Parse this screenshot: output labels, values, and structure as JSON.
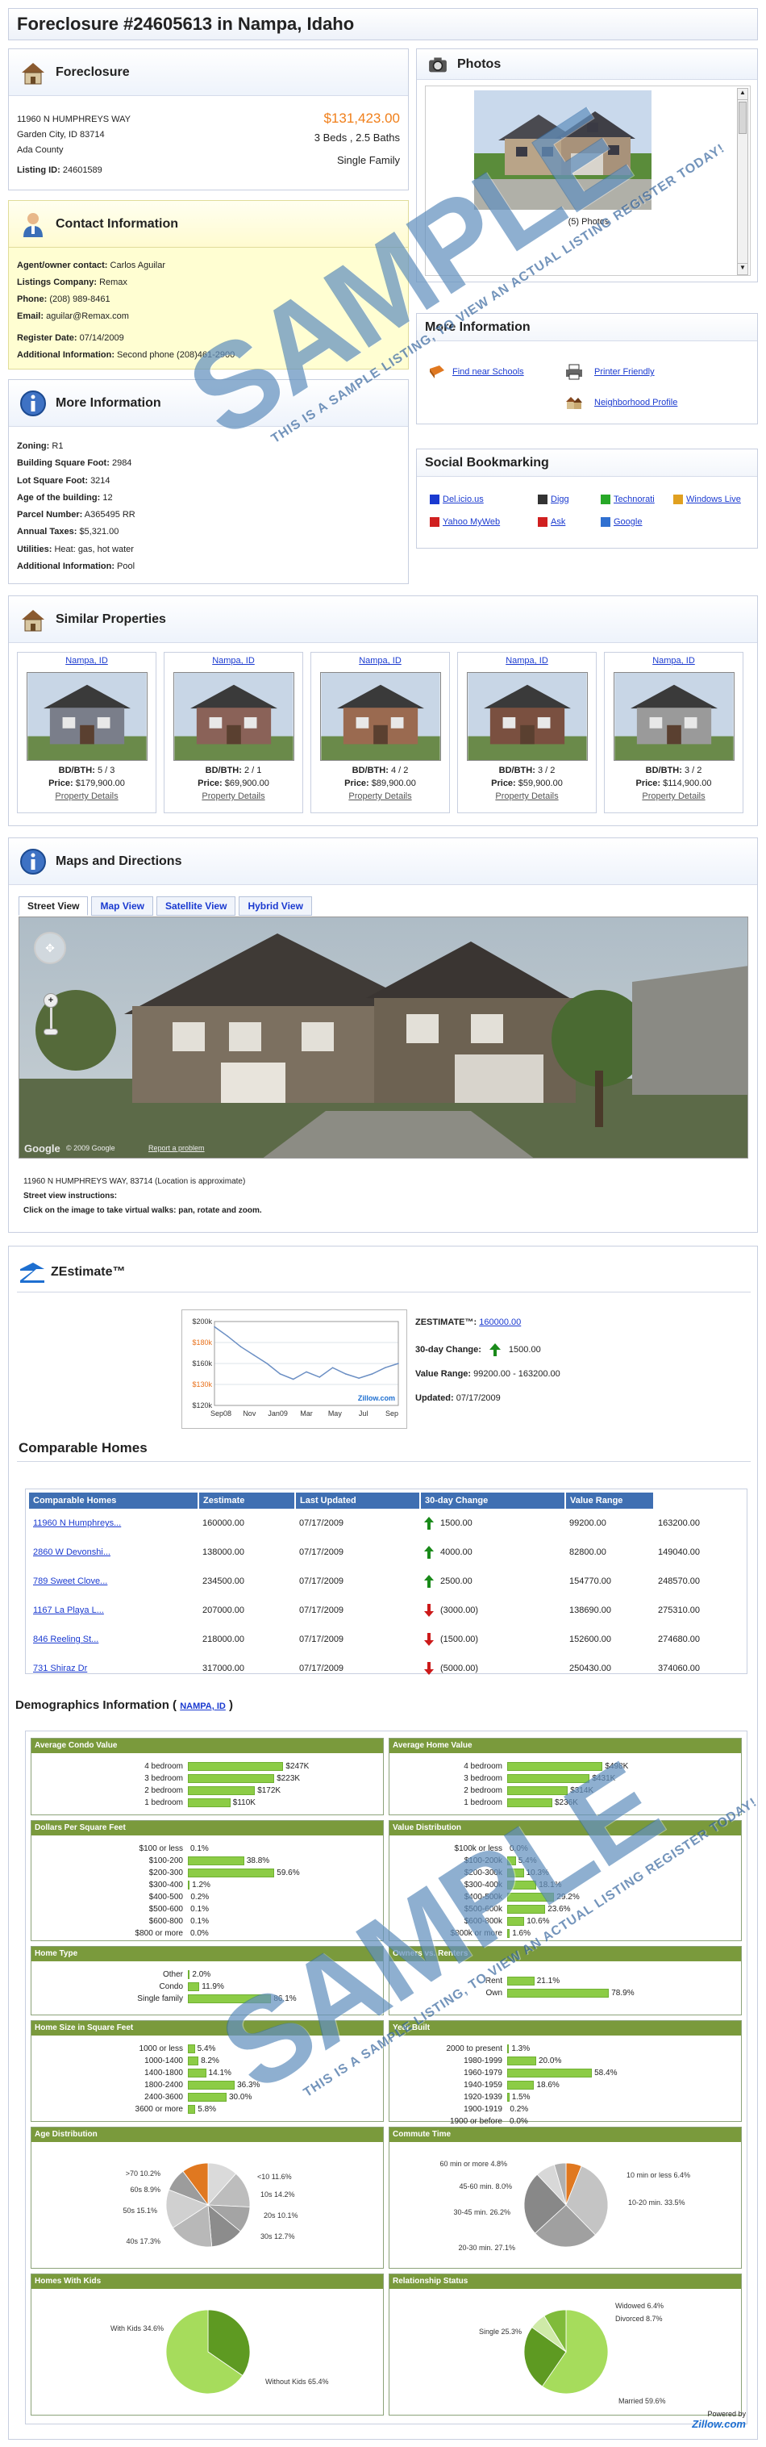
{
  "page_title": "Foreclosure #24605613 in Nampa, Idaho",
  "watermark": {
    "big": "SAMPLE",
    "small": "THIS IS A SAMPLE LISTING, TO VIEW AN ACTUAL LISTING REGISTER TODAY!"
  },
  "foreclosure": {
    "heading": "Foreclosure",
    "address1": "11960 N HUMPHREYS WAY",
    "address2": "Garden City, ID 83714",
    "county": "Ada County",
    "listing_label": "Listing ID:",
    "listing_id": "24601589",
    "price": "$131,423.00",
    "beds_baths": "3 Beds , 2.5 Baths",
    "type": "Single Family"
  },
  "contact": {
    "heading": "Contact Information",
    "rows": [
      {
        "label": "Agent/owner contact:",
        "value": "Carlos Aguilar"
      },
      {
        "label": "Listings Company:",
        "value": "Remax"
      },
      {
        "label": "Phone:",
        "value": "(208) 989-8461"
      },
      {
        "label": "Email:",
        "value": "aguilar@Remax.com"
      },
      {
        "label": "Register Date:",
        "value": "07/14/2009"
      },
      {
        "label": "Additional Information:",
        "value": "Second phone (208)461-2900"
      }
    ]
  },
  "more_info": {
    "heading": "More Information",
    "rows": [
      {
        "label": "Zoning:",
        "value": "R1"
      },
      {
        "label": "Building Square Foot:",
        "value": "2984"
      },
      {
        "label": "Lot Square Foot:",
        "value": "3214"
      },
      {
        "label": "Age of the building:",
        "value": "12"
      },
      {
        "label": "Parcel Number:",
        "value": "A365495 RR"
      },
      {
        "label": "Annual Taxes:",
        "value": "$5,321.00"
      },
      {
        "label": "Utilities:",
        "value": "Heat: gas, hot water"
      },
      {
        "label": "Additional Information:",
        "value": "Pool"
      }
    ]
  },
  "photos": {
    "heading": "Photos",
    "caption": "(5) Photos"
  },
  "more_links": {
    "heading": "More Information",
    "schools": "Find near Schools",
    "printer": "Printer Friendly",
    "neighborhood": "Neighborhood Profile"
  },
  "social": {
    "heading": "Social Bookmarking",
    "items": [
      "Del.icio.us",
      "Digg",
      "Technorati",
      "Windows Live",
      "Yahoo MyWeb",
      "Ask",
      "Google"
    ]
  },
  "similar": {
    "heading": "Similar Properties",
    "bd_label": "BD/BTH:",
    "price_label": "Price:",
    "details": "Property Details",
    "items": [
      {
        "city": "Nampa, ID",
        "bdbth": "5 / 3",
        "price": "$179,900.00",
        "color": "#7a7e8a"
      },
      {
        "city": "Nampa, ID",
        "bdbth": "2 / 1",
        "price": "$69,900.00",
        "color": "#8a6258"
      },
      {
        "city": "Nampa, ID",
        "bdbth": "4 / 2",
        "price": "$89,900.00",
        "color": "#9a6a50"
      },
      {
        "city": "Nampa, ID",
        "bdbth": "3 / 2",
        "price": "$59,900.00",
        "color": "#7a5040"
      },
      {
        "city": "Nampa, ID",
        "bdbth": "3 / 2",
        "price": "$114,900.00",
        "color": "#9a9a9a"
      }
    ]
  },
  "maps": {
    "heading": "Maps and Directions",
    "tabs": [
      "Street View",
      "Map View",
      "Satellite View",
      "Hybrid View"
    ],
    "copyright": "© 2009 Google",
    "report": "Report a problem",
    "location": "11960 N HUMPHREYS WAY, 83714 (Location is approximate)",
    "instr_title": "Street view instructions:",
    "instr": "Click on the image to take virtual walks: pan, rotate and zoom."
  },
  "zestimate": {
    "heading": "ZEstimate™",
    "label": "ZESTIMATE™:",
    "value": "160000.00",
    "change_label": "30-day Change:",
    "change": "1500.00",
    "range_label": "Value Range:",
    "range": "99200.00 - 163200.00",
    "updated_label": "Updated:",
    "updated": "07/17/2009",
    "zillow": "Zillow.com"
  },
  "chart_data": {
    "type": "line",
    "title": "",
    "x": [
      "Sep08",
      "Nov",
      "Jan09",
      "Mar",
      "May",
      "Jul",
      "Sep"
    ],
    "y_ticks": [
      "$200k",
      "$180k",
      "$160k",
      "$130k",
      "$120k"
    ],
    "series": [
      {
        "values": [
          195,
          186,
          176,
          168,
          160,
          150,
          145,
          152,
          147,
          156,
          150,
          146,
          150,
          156,
          160
        ]
      }
    ],
    "ylim": [
      120,
      200
    ],
    "xlabel": "",
    "ylabel": "",
    "grid": true
  },
  "comparable": {
    "heading": "Comparable Homes",
    "headers": [
      "Comparable Homes",
      "Zestimate",
      "Last Updated",
      "30-day Change",
      "Value Range"
    ],
    "rows": [
      {
        "name": "11960 N Humphreys...",
        "zest": "160000.00",
        "date": "07/17/2009",
        "dir": "up",
        "change": "1500.00",
        "low": "99200.00",
        "high": "163200.00"
      },
      {
        "name": "2860 W Devonshi...",
        "zest": "138000.00",
        "date": "07/17/2009",
        "dir": "up",
        "change": "4000.00",
        "low": "82800.00",
        "high": "149040.00"
      },
      {
        "name": "789 Sweet Clove...",
        "zest": "234500.00",
        "date": "07/17/2009",
        "dir": "up",
        "change": "2500.00",
        "low": "154770.00",
        "high": "248570.00"
      },
      {
        "name": "1167 La Playa L...",
        "zest": "207000.00",
        "date": "07/17/2009",
        "dir": "down",
        "change": "(3000.00)",
        "low": "138690.00",
        "high": "275310.00"
      },
      {
        "name": "846 Reeling St...",
        "zest": "218000.00",
        "date": "07/17/2009",
        "dir": "down",
        "change": "(1500.00)",
        "low": "152600.00",
        "high": "274680.00"
      },
      {
        "name": "731 Shiraz Dr",
        "zest": "317000.00",
        "date": "07/17/2009",
        "dir": "down",
        "change": "(5000.00)",
        "low": "250430.00",
        "high": "374060.00"
      }
    ]
  },
  "demographics": {
    "heading": "Demographics Information (",
    "city": "NAMPA, ID",
    "close": ")",
    "powered": "Powered by",
    "zillow": "Zillow.com",
    "condo": {
      "title": "Average Condo Value",
      "rows": [
        [
          "4 bedroom",
          0.74,
          "$247K"
        ],
        [
          "3 bedroom",
          0.67,
          "$223K"
        ],
        [
          "2 bedroom",
          0.52,
          "$172K"
        ],
        [
          "1 bedroom",
          0.33,
          "$110K"
        ]
      ]
    },
    "home": {
      "title": "Average Home Value",
      "rows": [
        [
          "4 bedroom",
          0.74,
          "$498K"
        ],
        [
          "3 bedroom",
          0.64,
          "$431K"
        ],
        [
          "2 bedroom",
          0.47,
          "$314K"
        ],
        [
          "1 bedroom",
          0.35,
          "$236K"
        ]
      ]
    },
    "sqft": {
      "title": "Dollars Per Square Feet",
      "rows": [
        [
          "$100 or less",
          0.0,
          "0.1%"
        ],
        [
          "$100-200",
          0.388,
          "38.8%"
        ],
        [
          "$200-300",
          0.596,
          "59.6%"
        ],
        [
          "$300-400",
          0.012,
          "1.2%"
        ],
        [
          "$400-500",
          0.002,
          "0.2%"
        ],
        [
          "$500-600",
          0.001,
          "0.1%"
        ],
        [
          "$600-800",
          0.001,
          "0.1%"
        ],
        [
          "$800 or more",
          0.0,
          "0.0%"
        ]
      ]
    },
    "value": {
      "title": "Value Distribution",
      "rows": [
        [
          "$100k or less",
          0.0,
          "0.0%"
        ],
        [
          "$100-200k",
          0.054,
          "5.4%"
        ],
        [
          "$200-300k",
          0.103,
          "10.3%"
        ],
        [
          "$300-400k",
          0.181,
          "18.1%"
        ],
        [
          "$400-500k",
          0.292,
          "29.2%"
        ],
        [
          "$500-600k",
          0.236,
          "23.6%"
        ],
        [
          "$600-800k",
          0.106,
          "10.6%"
        ],
        [
          "$800k or more",
          0.016,
          "1.6%"
        ]
      ]
    },
    "hometype": {
      "title": "Home Type",
      "rows": [
        [
          "Other",
          0.02,
          "2.0%"
        ],
        [
          "Condo",
          0.119,
          "11.9%"
        ],
        [
          "Single family",
          0.861,
          "86.1%"
        ]
      ]
    },
    "owners": {
      "title": "Owners vs. Renters",
      "rows": [
        [
          "Rent",
          0.211,
          "21.1%"
        ],
        [
          "Own",
          0.789,
          "78.9%"
        ]
      ]
    },
    "homesize": {
      "title": "Home Size in Square Feet",
      "rows": [
        [
          "1000 or less",
          0.054,
          "5.4%"
        ],
        [
          "1000-1400",
          0.082,
          "8.2%"
        ],
        [
          "1400-1800",
          0.141,
          "14.1%"
        ],
        [
          "1800-2400",
          0.363,
          "36.3%"
        ],
        [
          "2400-3600",
          0.3,
          "30.0%"
        ],
        [
          "3600 or more",
          0.058,
          "5.8%"
        ]
      ]
    },
    "yearbuilt": {
      "title": "Year Built",
      "rows": [
        [
          "2000 to present",
          0.013,
          "1.3%"
        ],
        [
          "1980-1999",
          0.2,
          "20.0%"
        ],
        [
          "1960-1979",
          0.584,
          "58.4%"
        ],
        [
          "1940-1959",
          0.186,
          "18.6%"
        ],
        [
          "1920-1939",
          0.015,
          "1.5%"
        ],
        [
          "1900-1919",
          0.002,
          "0.2%"
        ],
        [
          "1900 or before",
          0.0,
          "0.0%"
        ]
      ]
    },
    "age": {
      "title": "Age Distribution",
      "labels": [
        ">70 10.2%",
        "60s 8.9%",
        "50s 15.1%",
        "40s 17.3%",
        "<10 11.6%",
        "10s 14.2%",
        "20s 10.1%",
        "30s 12.7%"
      ],
      "slices": [
        11.6,
        14.2,
        10.1,
        12.7,
        17.3,
        15.1,
        8.9,
        10.2
      ]
    },
    "commute": {
      "title": "Commute Time",
      "labels": [
        "60 min or more 4.8%",
        "45-60 min. 8.0%",
        "30-45 min. 26.2%",
        "20-30 min. 27.1%",
        "10 min or less 6.4%",
        "10-20 min. 33.5%"
      ],
      "slices": [
        6.4,
        33.5,
        27.1,
        26.2,
        8.0,
        4.8
      ]
    },
    "kids": {
      "title": "Homes With Kids",
      "labels": [
        "With Kids 34.6%",
        "Without Kids 65.4%"
      ],
      "slices": [
        34.6,
        65.4
      ]
    },
    "relationship": {
      "title": "Relationship Status",
      "labels": [
        "Single 25.3%",
        "Widowed 6.4%",
        "Divorced 8.7%",
        "Married 59.6%"
      ],
      "slices": [
        59.6,
        25.3,
        6.4,
        8.7
      ]
    }
  }
}
